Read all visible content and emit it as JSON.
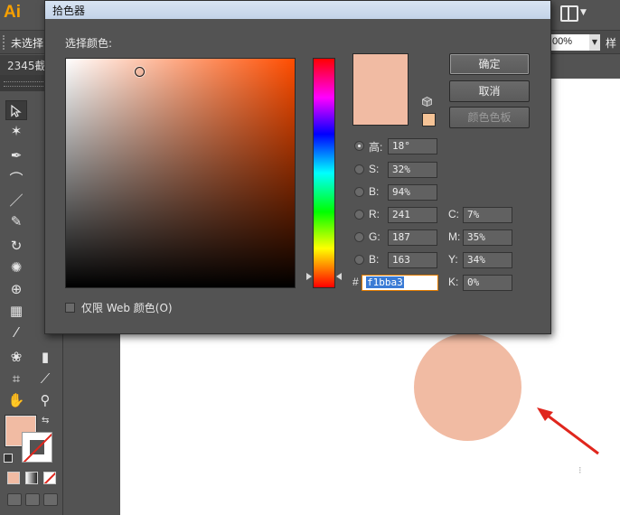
{
  "app": {
    "logo": "Ai"
  },
  "control_bar": {
    "selection_label": "未选择",
    "opacity_value": "00%",
    "style_label": "样"
  },
  "doc_tab": {
    "label": "2345截"
  },
  "dialog": {
    "title": "拾色器",
    "section_label": "选择颜色:",
    "buttons": {
      "ok": "确定",
      "cancel": "取消",
      "swatches": "颜色色板"
    },
    "fields": [
      {
        "key": "H",
        "label": "高:",
        "value": "18°",
        "selected": true
      },
      {
        "key": "S",
        "label": "S:",
        "value": "32%",
        "selected": false
      },
      {
        "key": "Bh",
        "label": "B:",
        "value": "94%",
        "selected": false
      },
      {
        "key": "R",
        "label": "R:",
        "value": "241",
        "selected": false
      },
      {
        "key": "G",
        "label": "G:",
        "value": "187",
        "selected": false
      },
      {
        "key": "Bb",
        "label": "B:",
        "value": "163",
        "selected": false
      }
    ],
    "cmyk": [
      {
        "label": "C:",
        "value": "7%"
      },
      {
        "label": "M:",
        "value": "35%"
      },
      {
        "label": "Y:",
        "value": "34%"
      },
      {
        "label": "K:",
        "value": "0%"
      }
    ],
    "hex_label": "#",
    "hex_value": "f1bba3",
    "web_only_label": "仅限 Web 颜色(O)",
    "web_only_checked": false,
    "saturation_fraction": 0.32,
    "brightness_fraction": 0.94,
    "hue_degrees": 18
  },
  "colors": {
    "selected": "#f1bba3",
    "web_safe_alert": "#f5c396",
    "hue_pure": "#ff4d00",
    "arrow": "#e0261d",
    "ai_orange": "#f7a000"
  },
  "icons": {
    "ai_logo": "ai-logo",
    "workspace": "workspace-switcher-icon",
    "gamut_warning": "cube-icon"
  }
}
